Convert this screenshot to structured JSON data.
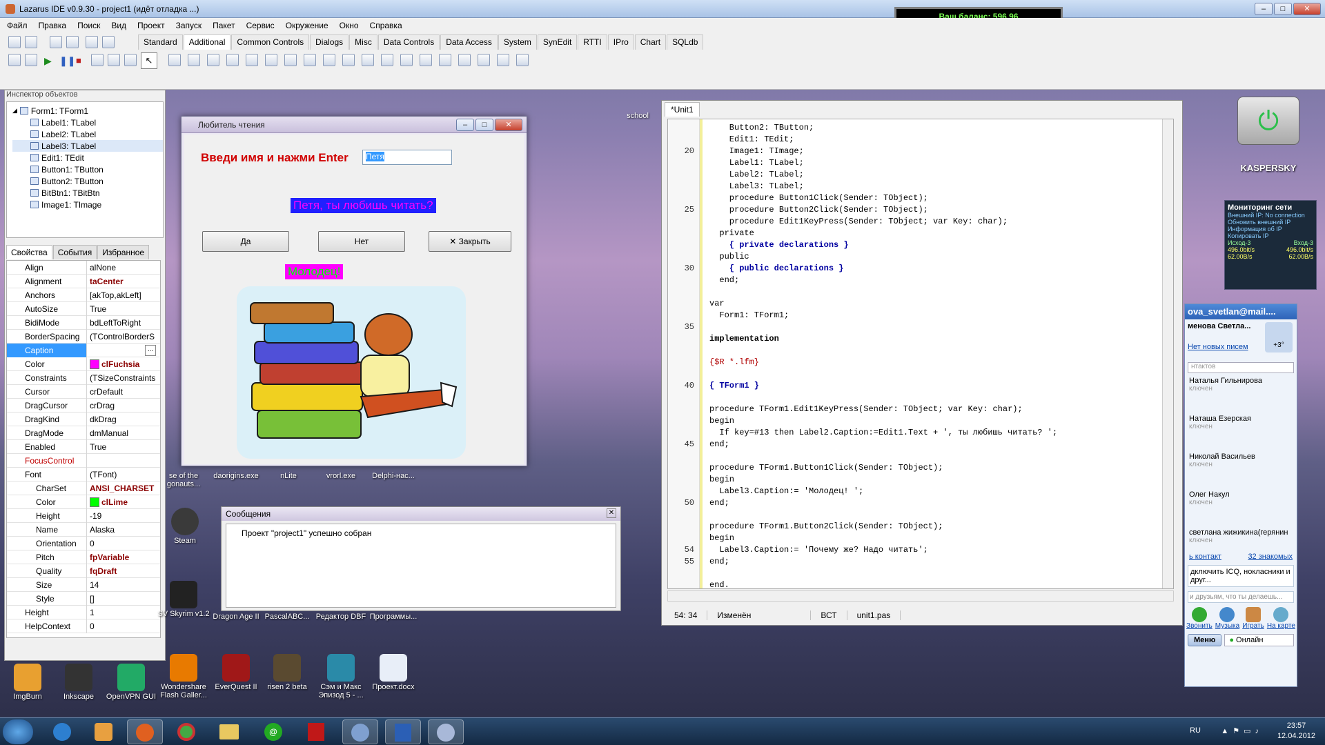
{
  "ide": {
    "title": "Lazarus IDE v0.9.30 - project1 (идёт отладка ...)",
    "menu": [
      "Файл",
      "Правка",
      "Поиск",
      "Вид",
      "Проект",
      "Запуск",
      "Пакет",
      "Сервис",
      "Окружение",
      "Окно",
      "Справка"
    ],
    "palette_tabs": [
      "Standard",
      "Additional",
      "Common Controls",
      "Dialogs",
      "Misc",
      "Data Controls",
      "Data Access",
      "System",
      "SynEdit",
      "RTTI",
      "IPro",
      "Chart",
      "SQLdb"
    ],
    "active_tab": "Additional"
  },
  "balance": "Ваш баланс: 596,96",
  "inspector": {
    "title": "Инспектор объектов",
    "root": "Form1: TForm1",
    "children": [
      "Label1: TLabel",
      "Label2: TLabel",
      "Label3: TLabel",
      "Edit1: TEdit",
      "Button1: TButton",
      "Button2: TButton",
      "BitBtn1: TBitBtn",
      "Image1: TImage"
    ],
    "tabs": [
      "Свойства",
      "События",
      "Избранное"
    ],
    "props": [
      {
        "n": "Align",
        "v": "alNone"
      },
      {
        "n": "Alignment",
        "v": "taCenter",
        "b": true
      },
      {
        "n": "Anchors",
        "v": "[akTop,akLeft]"
      },
      {
        "n": "AutoSize",
        "v": "True"
      },
      {
        "n": "BidiMode",
        "v": "bdLeftToRight"
      },
      {
        "n": "BorderSpacing",
        "v": "(TControlBorderS"
      },
      {
        "n": "Caption",
        "v": "",
        "sel": true
      },
      {
        "n": "Color",
        "v": "clFuchsia",
        "b": true,
        "sw": "#ff00ff"
      },
      {
        "n": "Constraints",
        "v": "(TSizeConstraints"
      },
      {
        "n": "Cursor",
        "v": "crDefault"
      },
      {
        "n": "DragCursor",
        "v": "crDrag"
      },
      {
        "n": "DragKind",
        "v": "dkDrag"
      },
      {
        "n": "DragMode",
        "v": "dmManual"
      },
      {
        "n": "Enabled",
        "v": "True"
      },
      {
        "n": "FocusControl",
        "v": "",
        "red": true
      },
      {
        "n": "Font",
        "v": "(TFont)"
      },
      {
        "n": "CharSet",
        "v": "ANSI_CHARSET",
        "b": true,
        "sub": true
      },
      {
        "n": "Color",
        "v": "clLime",
        "b": true,
        "sw": "#00ff00",
        "sub": true
      },
      {
        "n": "Height",
        "v": "-19",
        "sub": true
      },
      {
        "n": "Name",
        "v": "Alaska",
        "sub": true
      },
      {
        "n": "Orientation",
        "v": "0",
        "sub": true
      },
      {
        "n": "Pitch",
        "v": "fpVariable",
        "b": true,
        "sub": true
      },
      {
        "n": "Quality",
        "v": "fqDraft",
        "b": true,
        "sub": true
      },
      {
        "n": "Size",
        "v": "14",
        "sub": true
      },
      {
        "n": "Style",
        "v": "[]",
        "sub": true
      },
      {
        "n": "Height",
        "v": "1"
      },
      {
        "n": "HelpContext",
        "v": "0"
      }
    ]
  },
  "form": {
    "title": "Любитель чтения",
    "prompt": "Введи имя и нажми Enter",
    "edit_value": "Петя",
    "question": "Петя, ты любишь читать?",
    "btn_yes": "Да",
    "btn_no": "Нет",
    "btn_close": "Закрыть",
    "praise": "Молодец!"
  },
  "messages": {
    "title": "Сообщения",
    "text": "Проект \"project1\" успешно собран"
  },
  "editor": {
    "tab": "*Unit1",
    "lines": [
      {
        "t": "    Button2: TButton;"
      },
      {
        "t": "    Edit1: TEdit;"
      },
      {
        "t": "    Image1: TImage;",
        "n": "20"
      },
      {
        "t": "    Label1: TLabel;"
      },
      {
        "t": "    Label2: TLabel;"
      },
      {
        "t": "    Label3: TLabel;"
      },
      {
        "t": "    procedure Button1Click(Sender: TObject);"
      },
      {
        "t": "    procedure Button2Click(Sender: TObject);",
        "n": "25"
      },
      {
        "t": "    procedure Edit1KeyPress(Sender: TObject; var Key: char);"
      },
      {
        "t": "  private"
      },
      {
        "t": "    { private declarations }",
        "c": "cm"
      },
      {
        "t": "  public"
      },
      {
        "t": "    { public declarations }",
        "c": "cm",
        "n": "30"
      },
      {
        "t": "  end;"
      },
      {
        "t": ""
      },
      {
        "t": "var"
      },
      {
        "t": "  Form1: TForm1;"
      },
      {
        "t": "",
        "n": "35"
      },
      {
        "t": "implementation",
        "c": "kw"
      },
      {
        "t": ""
      },
      {
        "t": "{$R *.lfm}",
        "c": "dir"
      },
      {
        "t": ""
      },
      {
        "t": "{ TForm1 }",
        "c": "cm",
        "n": "40"
      },
      {
        "t": ""
      },
      {
        "t": "procedure TForm1.Edit1KeyPress(Sender: TObject; var Key: char);"
      },
      {
        "t": "begin"
      },
      {
        "t": "  If key=#13 then Label2.Caption:=Edit1.Text + ', ты любишь читать? ';"
      },
      {
        "t": "end;",
        "n": "45"
      },
      {
        "t": ""
      },
      {
        "t": "procedure TForm1.Button1Click(Sender: TObject);"
      },
      {
        "t": "begin"
      },
      {
        "t": "  Label3.Caption:= 'Молодец! ';"
      },
      {
        "t": "end;",
        "n": "50"
      },
      {
        "t": ""
      },
      {
        "t": "procedure TForm1.Button2Click(Sender: TObject);"
      },
      {
        "t": "begin"
      },
      {
        "t": "  Label3.Caption:= 'Почему же? Надо читать';",
        "n": "54"
      },
      {
        "t": "end;",
        "n": "55"
      },
      {
        "t": ""
      },
      {
        "t": "end."
      }
    ],
    "status": {
      "pos": "54: 34",
      "mod": "Изменён",
      "ins": "ВСТ",
      "file": "unit1.pas"
    }
  },
  "desktop_icons": [
    {
      "l": "ImgBurn"
    },
    {
      "l": "Inkscape"
    },
    {
      "l": "OpenVPN GUI"
    },
    {
      "l": "Wondershare Flash Galler..."
    },
    {
      "l": "EverQuest II"
    },
    {
      "l": "risen 2 beta"
    },
    {
      "l": "Сэм и Макс Эпизод 5 - ..."
    },
    {
      "l": "Проект.docx"
    },
    {
      "l": "SV Skyrim v1.2"
    },
    {
      "l": "Dragon Age II"
    },
    {
      "l": "PascalABC..."
    },
    {
      "l": "Редактор DBF"
    },
    {
      "l": "Программы..."
    },
    {
      "l": "Steam"
    },
    {
      "l": "se of the gonauts..."
    },
    {
      "l": "daorigins.exe"
    },
    {
      "l": "nLite"
    },
    {
      "l": "vrorl.exe"
    },
    {
      "l": "Delphi-нас..."
    },
    {
      "l": "school"
    }
  ],
  "network": {
    "title": "Мониторинг сети",
    "line1": "Внешний IP: No connection",
    "line2": "Обновить внешний IP",
    "line3": "Информация об IP",
    "line4": "Копировать IP",
    "out": "Исход-3",
    "in": "Вход-3",
    "rate1": "496.0bit/s",
    "rate2": "496.0bit/s",
    "b1": "62.00B/s",
    "b2": "62.00B/s"
  },
  "kaspersky": "KASPERSKY",
  "agent": {
    "title": "ova_svetlan@mail....",
    "name": "менова Светла...",
    "mail": "Нет новых писем",
    "weather": "+3°",
    "search": "нтактов",
    "contacts": [
      {
        "name": "Наталья Гильнирова",
        "st": "ключен"
      },
      {
        "name": "Наташа Езерская",
        "st": "ключен"
      },
      {
        "name": "Николай Васильев",
        "st": "ключен"
      },
      {
        "name": "Олег Накул",
        "st": "ключен"
      },
      {
        "name": "светлана жижикина(герянин",
        "st": "ключен"
      }
    ],
    "add": "ь контакт",
    "acq": "32 знакомых",
    "promo": "дключить ICQ, нокласники и друг...",
    "friends": "и друзьям, что ты делаешь...",
    "actions": [
      "Звонить",
      "Музыка",
      "Играть",
      "На карте"
    ],
    "menu": "Меню",
    "online": "Онлайн"
  },
  "tray": {
    "lang": "RU",
    "time": "23:57",
    "date": "12.04.2012"
  }
}
